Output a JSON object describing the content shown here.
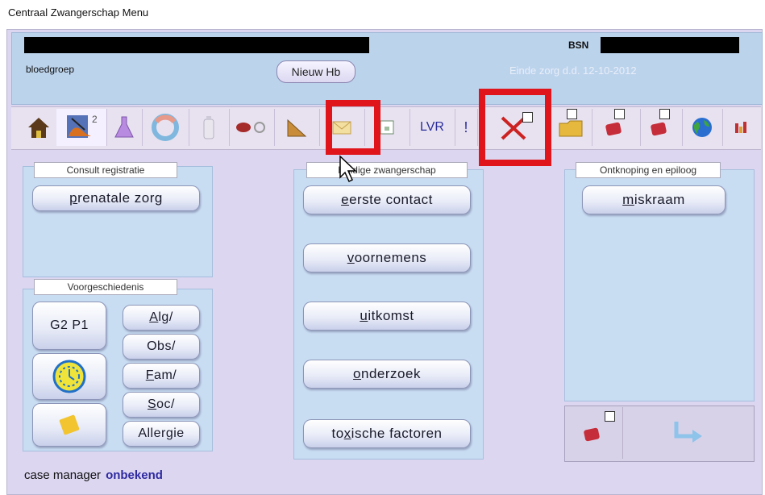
{
  "window": {
    "title": "Centraal Zwangerschap Menu"
  },
  "header": {
    "bsn_label": "BSN",
    "bloodgroup_label": "bloedgroep",
    "new_hb_label": "Nieuw Hb",
    "end_care_text": "Einde zorg d.d. 12-10-2012"
  },
  "toolbar": {
    "pregnancy_count": "2",
    "lvr_label": "LVR",
    "items": [
      "home-icon",
      "pregnancy-overview-icon",
      "flask-icon",
      "cycle-icon",
      "bottle-icon",
      "tools-icon",
      "ruler-icon",
      "envelope-icon",
      "form-icon",
      "lvr",
      "exclamation-icon",
      "close-x-icon",
      "folder-icon",
      "book-icon",
      "book-icon",
      "globe-icon",
      "chart-icon"
    ]
  },
  "panels": {
    "consult": {
      "title": "Consult registratie",
      "prenatal_label": "prenatale zorg",
      "prenatal_ul": "p",
      "prenatal_rest": "renatale zorg"
    },
    "history": {
      "title": "Voorgeschiedenis",
      "gp_label": "G2 P1",
      "alg_ul": "A",
      "alg_rest": "lg/",
      "obs_label": "Obs/",
      "fam_ul": "F",
      "fam_rest": "am/",
      "soc_ul": "S",
      "soc_rest": "oc/",
      "allergy_label": "Allergie"
    },
    "current": {
      "title": "Huidige zwangerschap",
      "first_ul": "e",
      "first_rest": "erste contact",
      "plans_ul": "v",
      "plans_rest": "oornemens",
      "outcome_ul": "u",
      "outcome_rest": "itkomst",
      "research_ul": "o",
      "research_rest": "nderzoek",
      "toxic_pre": "to",
      "toxic_ul": "x",
      "toxic_rest": "ische factoren"
    },
    "closure": {
      "title": "Ontknoping en epiloog",
      "miscarriage_ul": "m",
      "miscarriage_rest": "iskraam"
    }
  },
  "footer": {
    "label": "case manager",
    "value": "onbekend"
  },
  "colors": {
    "highlight": "#e0151b",
    "panel": "#c8dcf2",
    "background": "#dcd6f0"
  }
}
